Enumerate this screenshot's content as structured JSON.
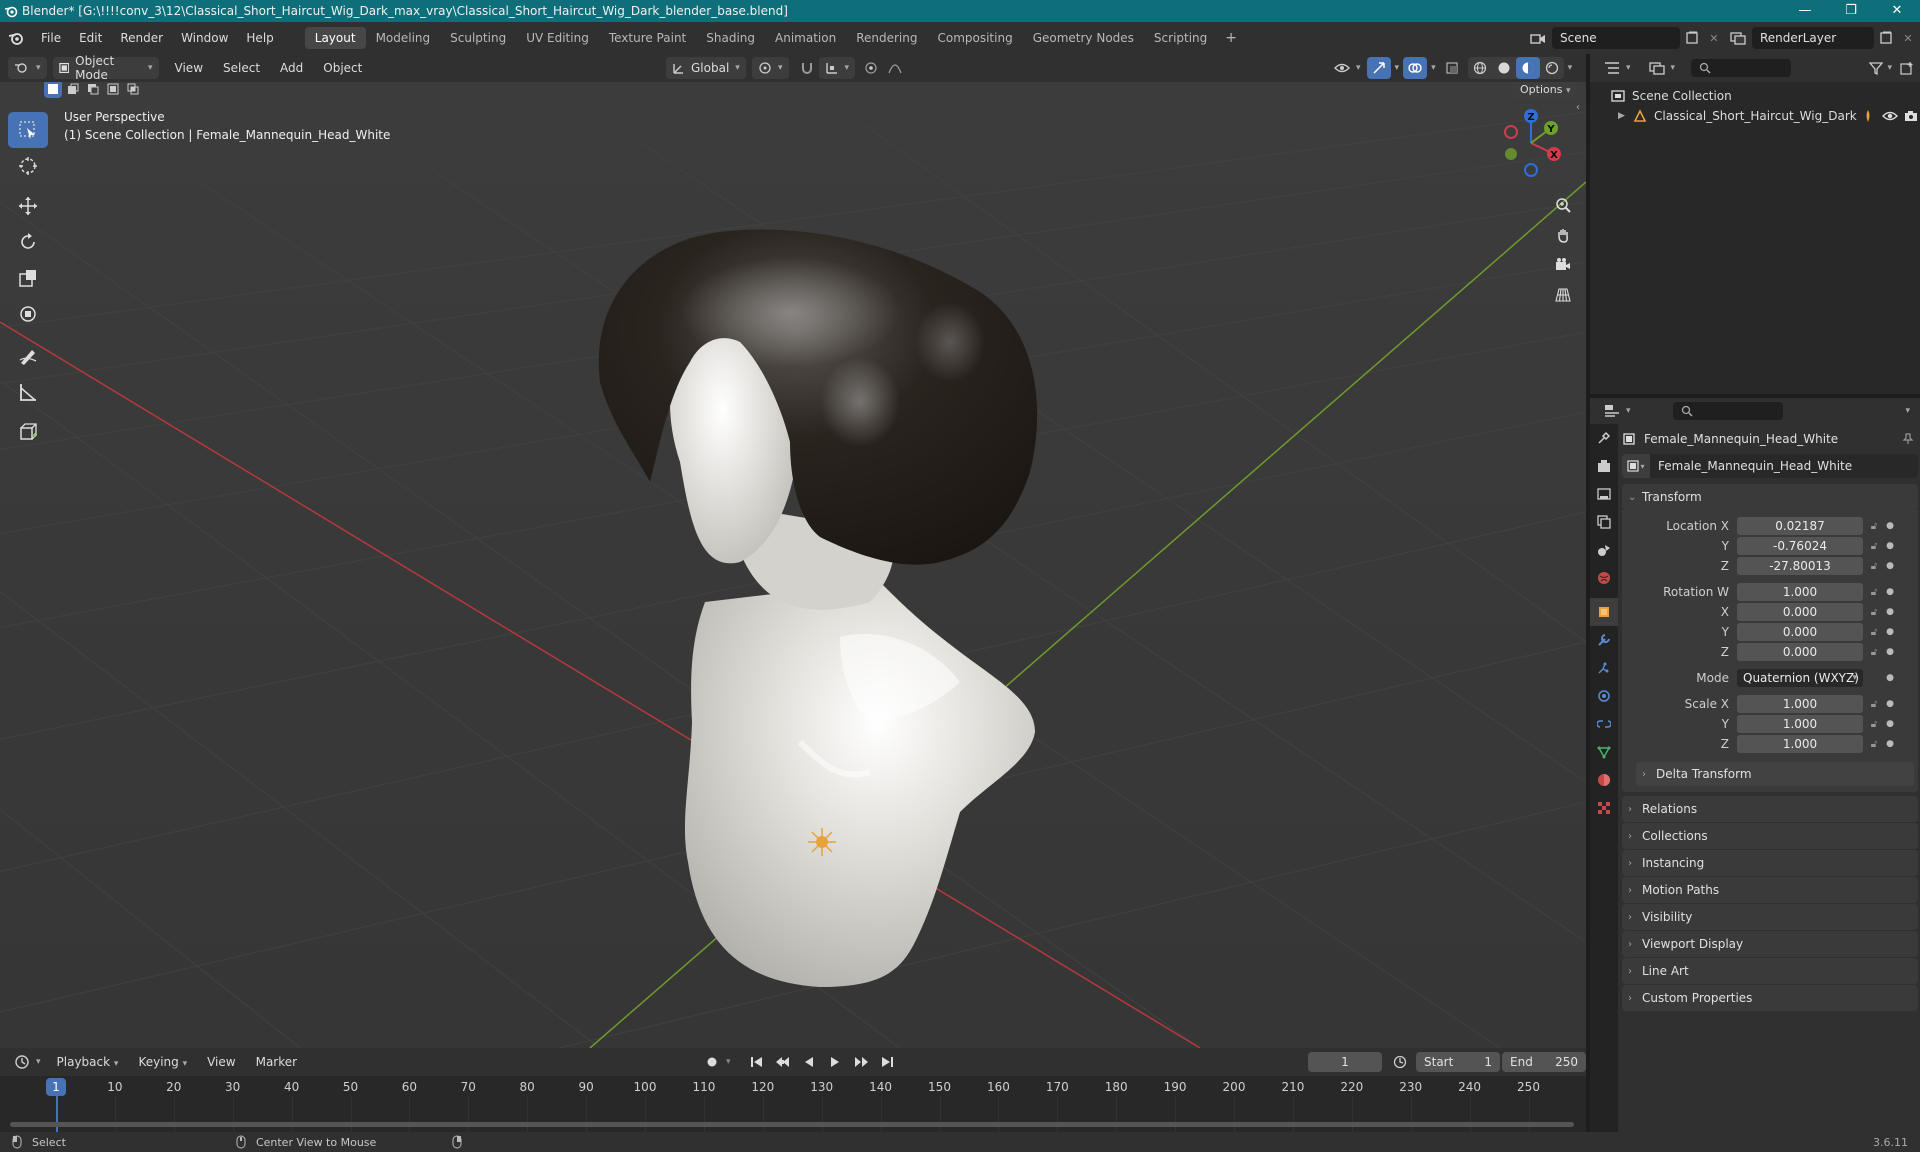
{
  "window": {
    "title": "Blender* [G:\\!!!!conv_3\\12\\Classical_Short_Haircut_Wig_Dark_max_vray\\Classical_Short_Haircut_Wig_Dark_blender_base.blend]",
    "minimize": "—",
    "maximize": "❐",
    "close": "✕"
  },
  "menus": [
    "File",
    "Edit",
    "Render",
    "Window",
    "Help"
  ],
  "workspaces": [
    {
      "label": "Layout",
      "active": true
    },
    {
      "label": "Modeling"
    },
    {
      "label": "Sculpting"
    },
    {
      "label": "UV Editing"
    },
    {
      "label": "Texture Paint"
    },
    {
      "label": "Shading"
    },
    {
      "label": "Animation"
    },
    {
      "label": "Rendering"
    },
    {
      "label": "Compositing"
    },
    {
      "label": "Geometry Nodes"
    },
    {
      "label": "Scripting"
    }
  ],
  "add_workspace": "+",
  "scene": {
    "name": "Scene",
    "render_layer": "RenderLayer"
  },
  "viewport_header": {
    "mode": "Object Mode",
    "menus": [
      "View",
      "Select",
      "Add",
      "Object"
    ],
    "orientation": "Global",
    "options": "Options"
  },
  "viewport": {
    "perspective": "User Perspective",
    "collection_info": "(1) Scene Collection | Female_Mannequin_Head_White"
  },
  "gizmo": {
    "x": "X",
    "y": "Y",
    "z": "Z"
  },
  "outliner": {
    "root": "Scene Collection",
    "items": [
      {
        "name": "Classical_Short_Haircut_Wig_Dark"
      }
    ]
  },
  "properties": {
    "object_name": "Female_Mannequin_Head_White",
    "data_name": "Female_Mannequin_Head_White",
    "transform_label": "Transform",
    "location": {
      "label": "Location X",
      "x": "0.02187",
      "y": "-0.76024",
      "z": "-27.80013"
    },
    "rotation": {
      "label": "Rotation W",
      "w": "1.000",
      "x": "0.000",
      "y": "0.000",
      "z": "0.000"
    },
    "mode_label": "Mode",
    "mode_value": "Quaternion (WXYZ)",
    "scale": {
      "label": "Scale X",
      "x": "1.000",
      "y": "1.000",
      "z": "1.000"
    },
    "axis_labels": {
      "y": "Y",
      "x": "X",
      "z": "Z"
    },
    "delta_transform": "Delta Transform",
    "panels": [
      "Relations",
      "Collections",
      "Instancing",
      "Motion Paths",
      "Visibility",
      "Viewport Display",
      "Line Art",
      "Custom Properties"
    ]
  },
  "timeline": {
    "menus": [
      "Playback",
      "Keying",
      "View",
      "Marker"
    ],
    "current_frame": "1",
    "start_label": "Start",
    "start": "1",
    "end_label": "End",
    "end": "250",
    "ruler": [
      "1",
      "10",
      "20",
      "30",
      "40",
      "50",
      "60",
      "70",
      "80",
      "90",
      "100",
      "110",
      "120",
      "130",
      "140",
      "150",
      "160",
      "170",
      "180",
      "190",
      "200",
      "210",
      "220",
      "230",
      "240",
      "250"
    ]
  },
  "status": {
    "select": "Select",
    "center_view": "Center View to Mouse",
    "version": "3.6.11"
  }
}
